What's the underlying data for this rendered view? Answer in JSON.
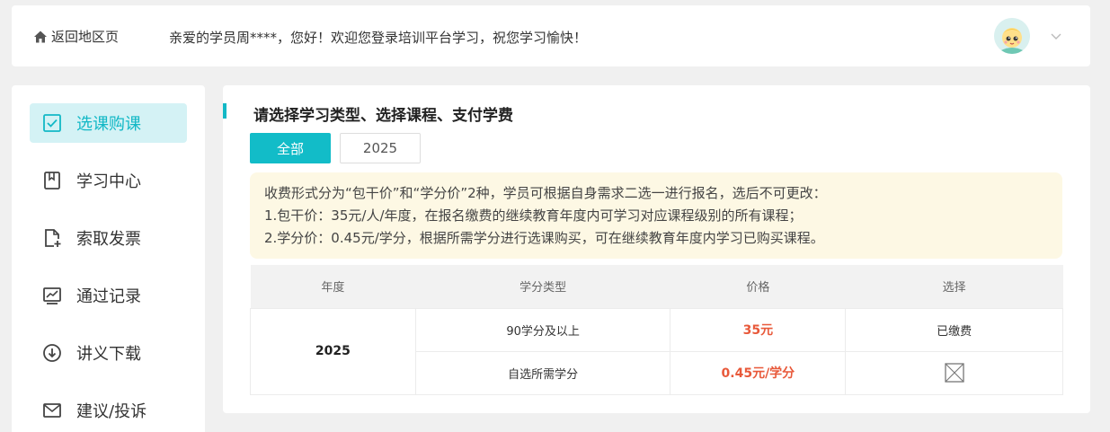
{
  "header": {
    "back_label": "返回地区页",
    "welcome": "亲爱的学员周****，您好！欢迎您登录培训平台学习，祝您学习愉快！"
  },
  "sidebar": {
    "items": [
      {
        "label": "选课购课",
        "icon": "checkbox-icon",
        "active": true
      },
      {
        "label": "学习中心",
        "icon": "bookmark-icon"
      },
      {
        "label": "索取发票",
        "icon": "invoice-icon"
      },
      {
        "label": "通过记录",
        "icon": "chart-icon"
      },
      {
        "label": "讲义下载",
        "icon": "download-icon"
      },
      {
        "label": "建议/投诉",
        "icon": "mail-icon"
      }
    ]
  },
  "main": {
    "title": "请选择学习类型、选择课程、支付学费",
    "tabs": [
      "全部",
      "2025"
    ],
    "notice": [
      "收费形式分为“包干价”和“学分价”2种，学员可根据自身需求二选一进行报名，选后不可更改：",
      "1.包干价：35元/人/年度，在报名缴费的继续教育年度内可学习对应课程级别的所有课程；",
      "2.学分价：0.45元/学分，根据所需学分进行选课购买，可在继续教育年度内学习已购买课程。"
    ],
    "table": {
      "headers": [
        "年度",
        "学分类型",
        "价格",
        "选择"
      ],
      "year": "2025",
      "rows": [
        {
          "type": "90学分及以上",
          "price": "35元",
          "choice": "已缴费"
        },
        {
          "type": "自选所需学分",
          "price": "0.45元/学分",
          "choice": ""
        }
      ]
    }
  },
  "colors": {
    "accent": "#12bcc8",
    "price": "#e8593a",
    "notice_bg": "#fdf8e4"
  }
}
